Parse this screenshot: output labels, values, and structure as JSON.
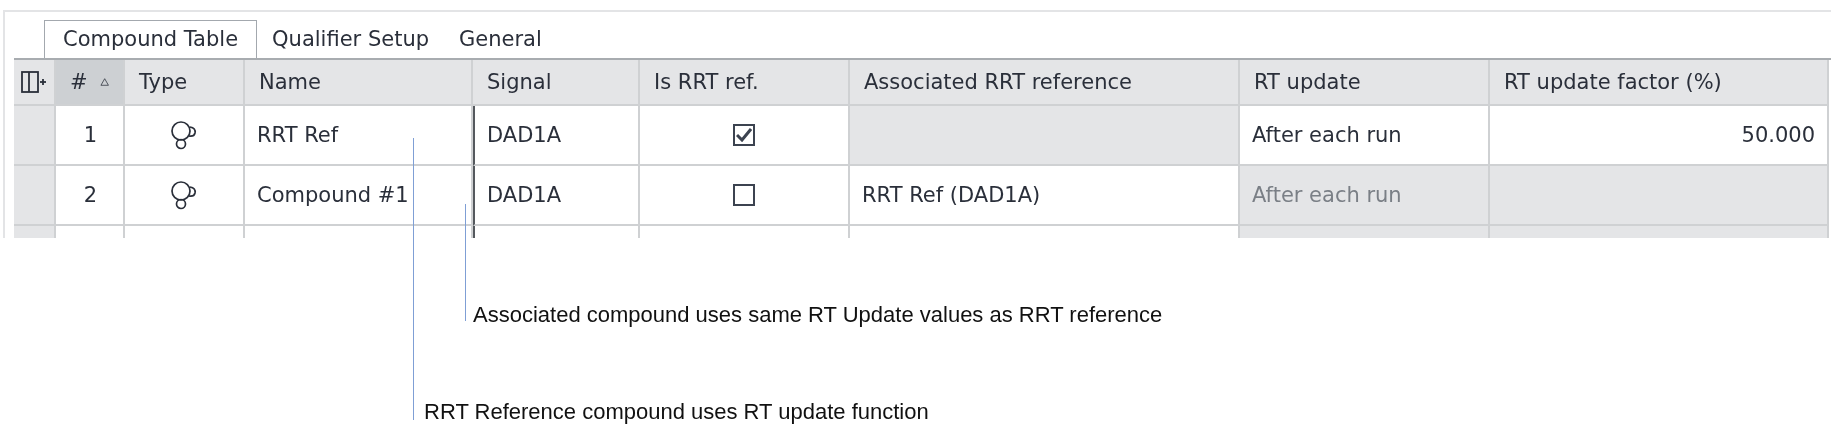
{
  "tabs": [
    {
      "label": "Compound Table",
      "selected": true
    },
    {
      "label": "Qualifier Setup",
      "selected": false
    },
    {
      "label": "General",
      "selected": false
    }
  ],
  "table": {
    "columns": [
      {
        "label": "#",
        "sorted": true
      },
      {
        "label": "Type",
        "sorted": false
      },
      {
        "label": "Name",
        "sorted": false
      },
      {
        "label": "Signal",
        "sorted": false
      },
      {
        "label": "Is RRT ref.",
        "sorted": false
      },
      {
        "label": "Associated RRT reference",
        "sorted": false
      },
      {
        "label": "RT update",
        "sorted": false
      },
      {
        "label": "RT update factor (%)",
        "sorted": false
      }
    ],
    "rows": [
      {
        "number": "1",
        "name": "RRT Ref",
        "signal": "DAD1A",
        "is_rrt_ref": {
          "checked": true
        },
        "associated_rrt_reference": {
          "disabled": true
        },
        "rt_update": {
          "value": "After each run",
          "disabled": false
        },
        "rt_update_factor": {
          "value": "50.000",
          "disabled": false
        }
      },
      {
        "number": "2",
        "name": "Compound #1",
        "signal": "DAD1A",
        "is_rrt_ref": {
          "checked": false
        },
        "associated_rrt_reference": {
          "value": "RRT Ref (DAD1A)",
          "disabled": false
        },
        "rt_update": {
          "value": "After each run",
          "disabled": true
        },
        "rt_update_factor": {
          "disabled": true
        }
      }
    ]
  },
  "annotations": [
    {
      "text": "Associated compound uses same RT Update values as RRT reference"
    },
    {
      "text": "RRT Reference compound uses RT update function"
    }
  ]
}
